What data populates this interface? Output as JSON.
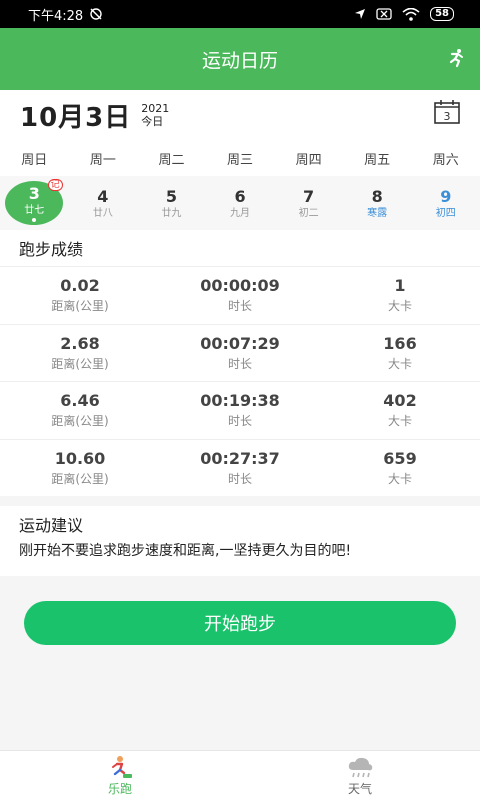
{
  "status_bar": {
    "time": "下午4:28",
    "battery": "58"
  },
  "app_bar": {
    "title": "运动日历"
  },
  "date_header": {
    "date": "10月3日",
    "year": "2021",
    "today_label": "今日",
    "calendar_day": "3"
  },
  "weekdays": [
    "周日",
    "周一",
    "周二",
    "周三",
    "周四",
    "周五",
    "周六"
  ],
  "days": [
    {
      "num": "3",
      "lunar": "廿七",
      "badge": "记"
    },
    {
      "num": "4",
      "lunar": "廿八"
    },
    {
      "num": "5",
      "lunar": "廿九"
    },
    {
      "num": "6",
      "lunar": "九月"
    },
    {
      "num": "7",
      "lunar": "初二"
    },
    {
      "num": "8",
      "lunar": "寒露"
    },
    {
      "num": "9",
      "lunar": "初四"
    }
  ],
  "records_section": {
    "title": "跑步成绩"
  },
  "labels": {
    "distance": "距离(公里)",
    "duration": "时长",
    "calories": "大卡"
  },
  "records": [
    {
      "distance": "0.02",
      "duration": "00:00:09",
      "calories": "1"
    },
    {
      "distance": "2.68",
      "duration": "00:07:29",
      "calories": "166"
    },
    {
      "distance": "6.46",
      "duration": "00:19:38",
      "calories": "402"
    },
    {
      "distance": "10.60",
      "duration": "00:27:37",
      "calories": "659"
    }
  ],
  "advice": {
    "title": "运动建议",
    "text": "刚开始不要追求跑步速度和距离,一坚持更久为目的吧!"
  },
  "start_button": {
    "label": "开始跑步"
  },
  "bottom_nav": [
    {
      "label": "乐跑",
      "icon": "runner-icon"
    },
    {
      "label": "天气",
      "icon": "cloud-rain-icon"
    }
  ]
}
